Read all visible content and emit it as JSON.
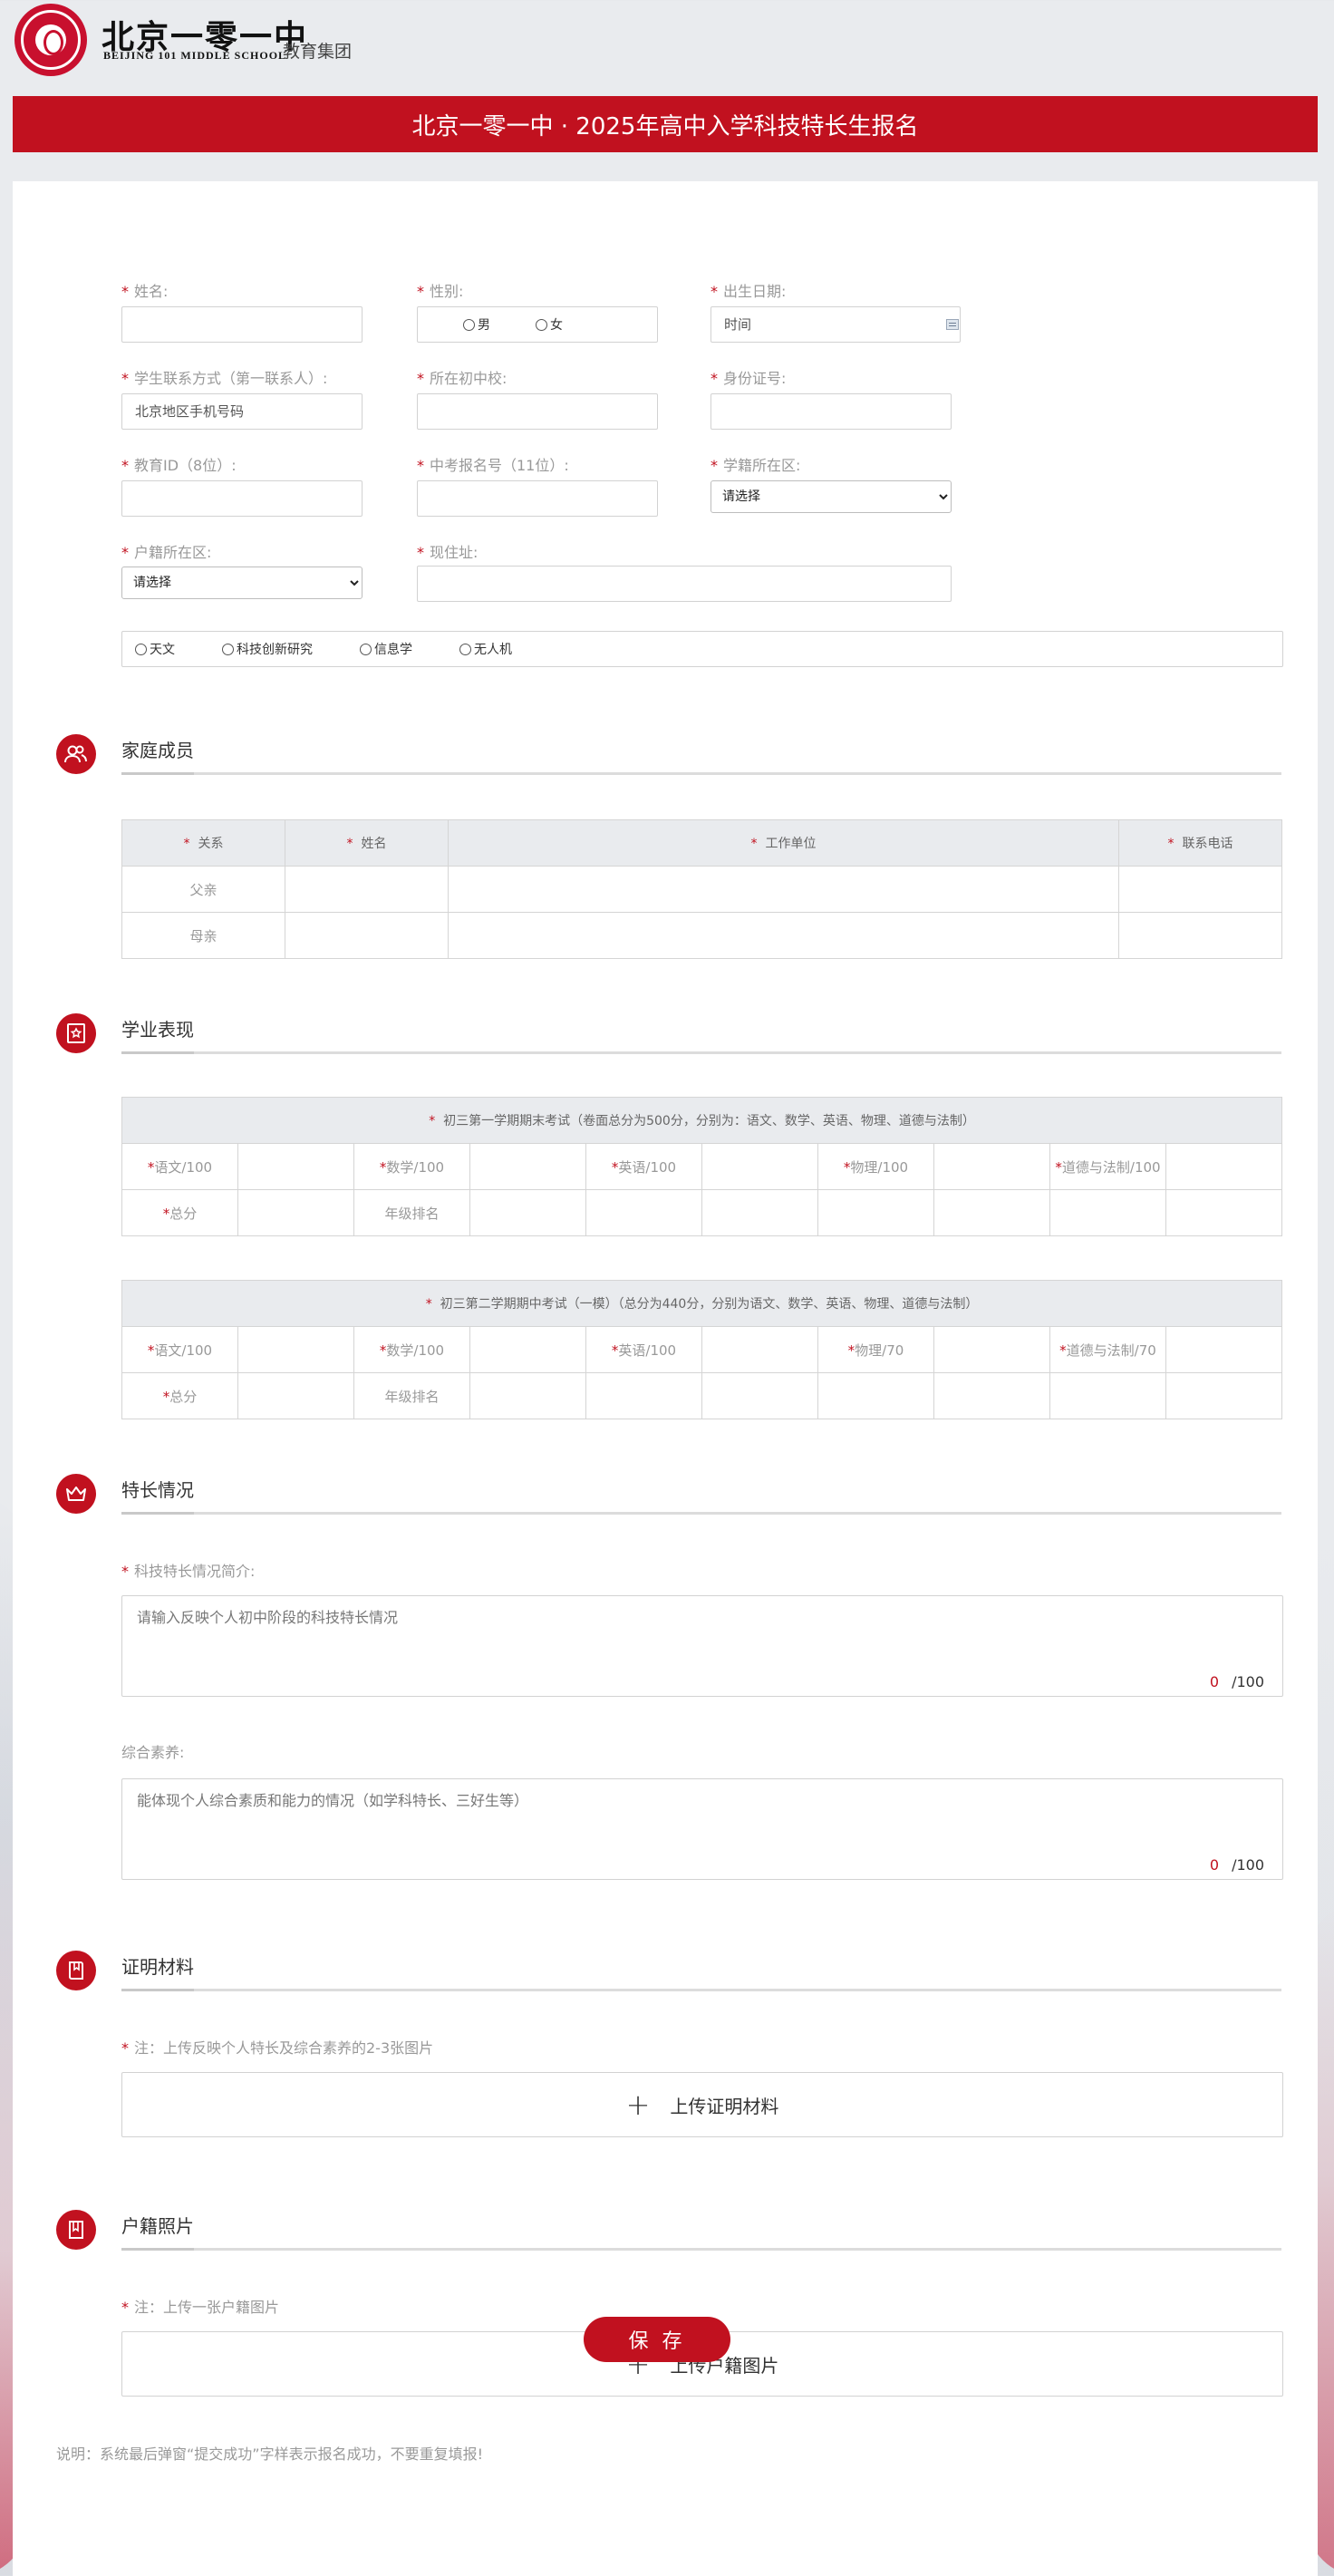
{
  "header": {
    "logo_cn": "北京一零一中",
    "logo_en": "BEIJING 101 MIDDLE SCHOOL",
    "group_text": "教育集团",
    "title": "北京一零一中 · 2025年高中入学科技特长生报名"
  },
  "colors": {
    "brand": "#c1111f",
    "header_bg": "#e9ebee"
  },
  "basic": {
    "name_label": "姓名:",
    "gender_label": "性别:",
    "gender_options": [
      "男",
      "女"
    ],
    "birth_label": "出生日期:",
    "birth_placeholder": "时间",
    "phone_label": "学生联系方式（第一联系人）:",
    "phone_placeholder": "北京地区手机号码",
    "school_label": "所在初中校:",
    "id_label": "身份证号:",
    "edu_id_label": "教育ID（8位）:",
    "exam_no_label": "中考报名号（11位）:",
    "enroll_district_label": "学籍所在区:",
    "enroll_district_value": "请选择",
    "household_district_label": "户籍所在区:",
    "household_district_value": "请选择",
    "address_label": "现住址:",
    "interest_options": [
      "天文",
      "科技创新研究",
      "信息学",
      "无人机"
    ]
  },
  "family": {
    "title": "家庭成员",
    "icon": "people-icon",
    "headers": [
      "关系",
      "姓名",
      "工作单位",
      "联系电话"
    ],
    "rows": [
      "父亲",
      "母亲"
    ]
  },
  "academic": {
    "title": "学业表现",
    "icon": "certificate-icon",
    "exam1": {
      "caption": "初三第一学期期末考试（卷面总分为500分，分别为：语文、数学、英语、物理、道德与法制）",
      "subjects": [
        "语文/100",
        "数学/100",
        "英语/100",
        "物理/100",
        "道德与法制/100"
      ],
      "total_label": "总分",
      "rank_label": "年级排名"
    },
    "exam2": {
      "caption": "初三第二学期期中考试（一模）（总分为440分，分别为语文、数学、英语、物理、道德与法制）",
      "subjects": [
        "语文/100",
        "数学/100",
        "英语/100",
        "物理/70",
        "道德与法制/70"
      ],
      "total_label": "总分",
      "rank_label": "年级排名"
    }
  },
  "talent": {
    "title": "特长情况",
    "icon": "crown-icon",
    "intro_label": "科技特长情况简介:",
    "intro_placeholder": "请输入反映个人初中阶段的科技特长情况",
    "intro_count": "0",
    "intro_max": "/100",
    "quality_label": "综合素养:",
    "quality_placeholder": "能体现个人综合素质和能力的情况（如学科特长、三好生等）",
    "quality_count": "0",
    "quality_max": "/100"
  },
  "proof": {
    "title": "证明材料",
    "icon": "book-icon",
    "note": "注：上传反映个人特长及综合素养的2-3张图片",
    "upload_label": "上传证明材料"
  },
  "household": {
    "title": "户籍照片",
    "icon": "booklet-icon",
    "note": "注：上传一张户籍图片",
    "upload_label": "上传户籍图片"
  },
  "footer": {
    "note": "说明：系统最后弹窗“提交成功”字样表示报名成功，不要重复填报!",
    "save_label": "保 存"
  }
}
